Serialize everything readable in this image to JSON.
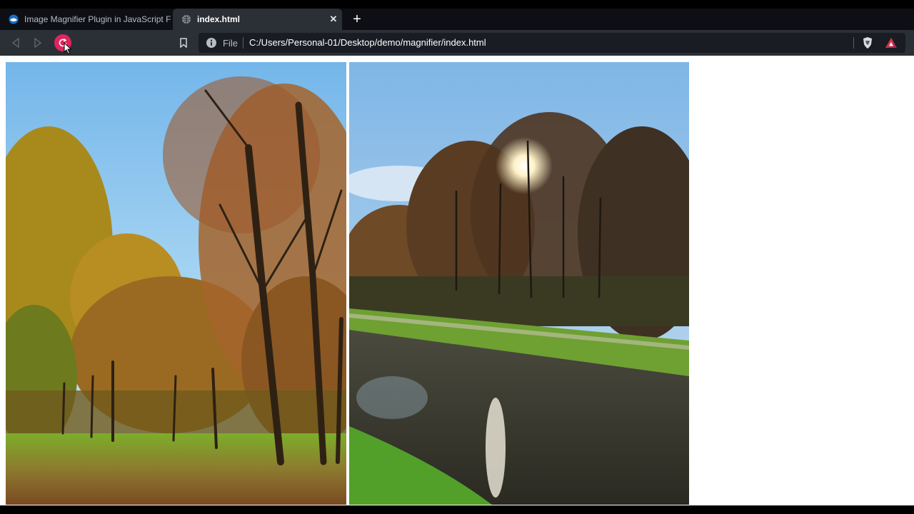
{
  "browser": {
    "tabs": [
      {
        "title": "Image Magnifier Plugin in JavaScript F",
        "active": false,
        "favicon": "site-logo-icon"
      },
      {
        "title": "index.html",
        "active": true,
        "favicon": "globe-icon"
      }
    ],
    "tab_close_glyph": "✕",
    "new_tab_glyph": "+",
    "address": {
      "scheme_label": "File",
      "url": "C:/Users/Personal-01/Desktop/demo/magnifier/index.html"
    },
    "icons": [
      "back-icon",
      "forward-icon",
      "reload-icon",
      "bookmark-icon",
      "info-icon",
      "brave-shield-icon",
      "brave-rewards-icon"
    ],
    "accent_colors": {
      "reload_highlight": "#e0245e",
      "tab_active_bg": "#2b2f36",
      "tabbar_bg": "#0d0f14"
    }
  },
  "page": {
    "images": [
      {
        "subject": "autumn-forest-trees"
      },
      {
        "subject": "river-sunset-trees"
      }
    ]
  }
}
